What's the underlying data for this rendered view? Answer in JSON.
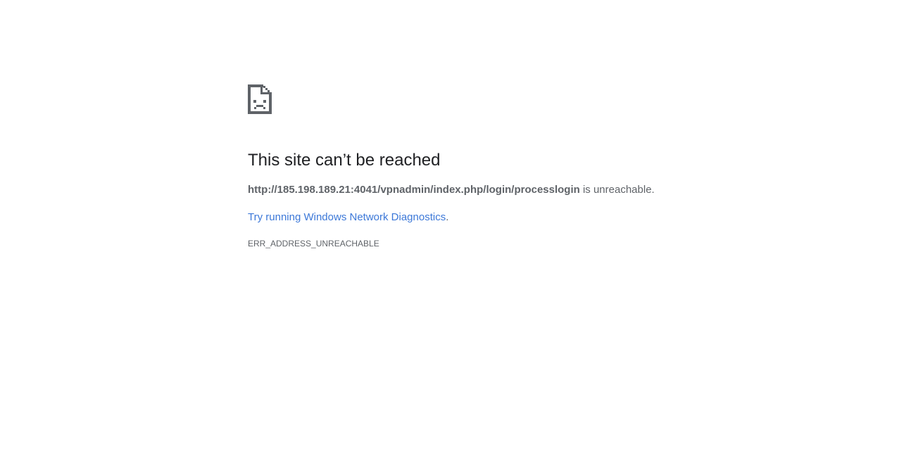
{
  "error_page": {
    "title": "This site can’t be reached",
    "url": "http://185.198.189.21:4041/vpnadmin/index.php/login/processlogin",
    "summary_suffix": " is unreachable.",
    "suggestion_link": "Try running Windows Network Diagnostics",
    "suggestion_suffix": ".",
    "error_code": "ERR_ADDRESS_UNREACHABLE",
    "icon": "sad-page-icon"
  },
  "colors": {
    "heading": "#202124",
    "body_text": "#5f6368",
    "link": "#3c78d8",
    "icon": "#5f6368"
  }
}
